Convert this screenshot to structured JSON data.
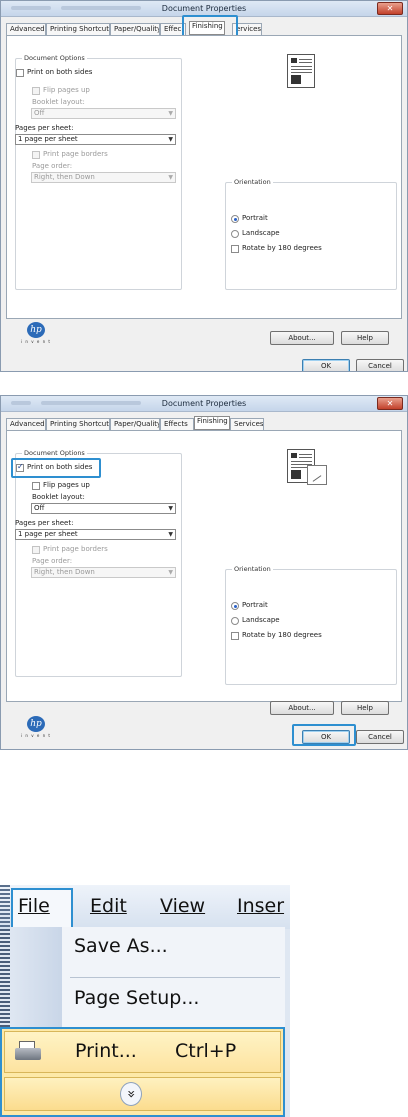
{
  "dialog1": {
    "title": "Document Properties",
    "close_glyph": "✕",
    "tabs": [
      "Advanced",
      "Printing Shortcuts",
      "Paper/Quality",
      "Effec",
      "Finishing",
      "Services"
    ],
    "services_tab_partial": "ervices",
    "document_options_legend": "Document Options",
    "print_both_sides": "Print on both sides",
    "flip_pages_up": "Flip pages up",
    "booklet_layout_label": "Booklet layout:",
    "booklet_layout_value": "Off",
    "pages_per_sheet_label": "Pages per sheet:",
    "pages_per_sheet_value": "1 page per sheet",
    "print_page_borders": "Print page borders",
    "page_order_label": "Page order:",
    "page_order_value": "Right, then Down",
    "orientation_legend": "Orientation",
    "portrait": "Portrait",
    "landscape": "Landscape",
    "rotate": "Rotate by 180 degrees",
    "about": "About...",
    "help": "Help",
    "ok": "OK",
    "cancel": "Cancel",
    "hp_logo": "hp",
    "invent": "i n v e n t"
  },
  "dialog2": {
    "title": "Document Properties",
    "close_glyph": "✕",
    "tabs": [
      "Advanced",
      "Printing Shortcuts",
      "Paper/Quality",
      "Effects",
      "Finishing",
      "Services"
    ],
    "document_options_legend": "Document Options",
    "print_both_sides": "Print on both sides",
    "flip_pages_up": "Flip pages up",
    "booklet_layout_label": "Booklet layout:",
    "booklet_layout_value": "Off",
    "pages_per_sheet_label": "Pages per sheet:",
    "pages_per_sheet_value": "1 page per sheet",
    "print_page_borders": "Print page borders",
    "page_order_label": "Page order:",
    "page_order_value": "Right, then Down",
    "orientation_legend": "Orientation",
    "portrait": "Portrait",
    "landscape": "Landscape",
    "rotate": "Rotate by 180 degrees",
    "about": "About...",
    "help": "Help",
    "ok": "OK",
    "cancel": "Cancel",
    "hp_logo": "hp",
    "invent": "i n v e n t"
  },
  "menu": {
    "bar": [
      "File",
      "Edit",
      "View",
      "Inser"
    ],
    "save_as": "Save As...",
    "page_setup": "Page Setup...",
    "print": "Print...",
    "shortcut": "Ctrl+P",
    "expand_glyph": "»"
  },
  "colors": {
    "highlight": "#2e8fd0",
    "accent_blue": "#2c6bb8"
  }
}
